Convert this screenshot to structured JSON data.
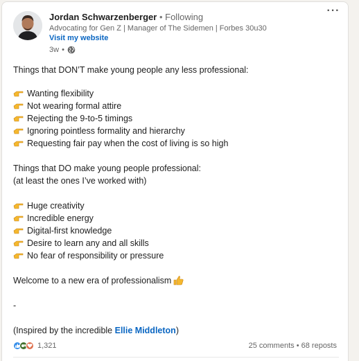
{
  "post": {
    "author": {
      "name": "Jordan Schwarzenberger",
      "separator": "•",
      "following": "Following",
      "headline": "Advocating for Gen Z | Manager of The Sidemen | Forbes 30u30",
      "website": "Visit my website",
      "time": "3w",
      "time_separator": "•"
    },
    "menu_icon": "more-horizontal-icon",
    "lines": {
      "intro1": "Things that DON’T make young people any less professional:",
      "list1": [
        "Wanting flexibility",
        "Not wearing formal attire",
        "Rejecting the 9-to-5 timings",
        "Ignoring pointless formality and hierarchy",
        "Requesting fair pay when the cost of living is so high"
      ],
      "intro2": "Things that DO make young people professional:",
      "intro2b": "(at least the ones I’ve worked with)",
      "list2": [
        "Huge creativity",
        "Incredible energy",
        "Digital-first knowledge",
        "Desire to learn any and all skills",
        "No fear of responsibility or pressure"
      ],
      "welcome": "Welcome to a new era of professionalism",
      "dash": "-",
      "inspired_pre": "(Inspired by the incredible ",
      "inspired_link": "Ellie Middleton",
      "inspired_post": ")"
    },
    "social": {
      "reaction_icons": [
        "like-icon",
        "celebrate-icon",
        "love-icon"
      ],
      "reaction_count": "1,321",
      "comments": "25 comments",
      "separator": "•",
      "reposts": "68 reposts"
    }
  }
}
